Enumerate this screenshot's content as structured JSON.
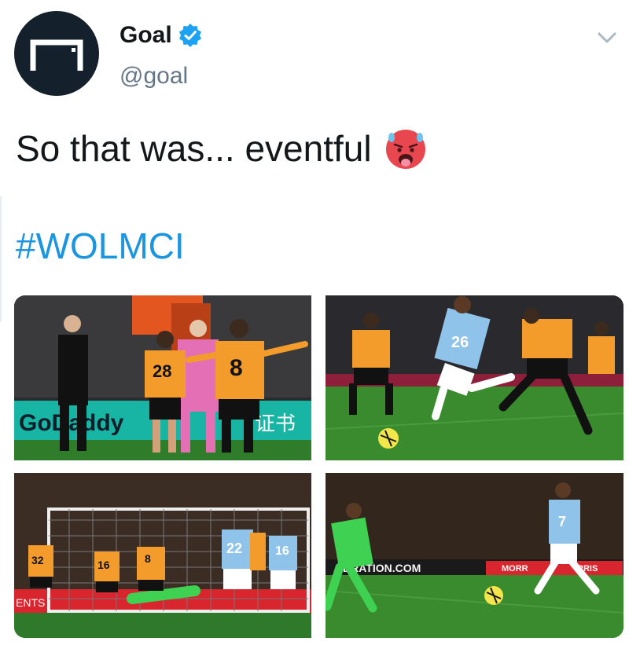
{
  "user": {
    "display_name": "Goal",
    "handle": "@goal",
    "avatar_icon": "goal-logo-icon",
    "verified_icon": "verified-badge-icon"
  },
  "tweet": {
    "text": "So that was... eventful",
    "emoji_icon": "hot-face-emoji-icon",
    "hashtag": "#WOLMCI"
  },
  "photos": {
    "p1": {
      "board_text": "GoDaddy",
      "board_text_2": "证书",
      "shirt_numbers": [
        "28",
        "8"
      ]
    },
    "p2": {
      "shirt_numbers": [
        "26"
      ]
    },
    "p3": {
      "board_text": "ENTS",
      "shirt_numbers": [
        "32",
        "16",
        "8",
        "22",
        "16"
      ]
    },
    "p4": {
      "board_text": "DRATION.COM",
      "board_text_2": "MORR",
      "board_text_3": "RRIS",
      "shirt_numbers": [
        "7"
      ]
    }
  },
  "colors": {
    "wolves_orange": "#f39c2b",
    "city_blue": "#8fc3ea",
    "pitch_green": "#2f7d2a",
    "link_blue": "#1b95e0",
    "avatar_bg": "#14202b"
  }
}
